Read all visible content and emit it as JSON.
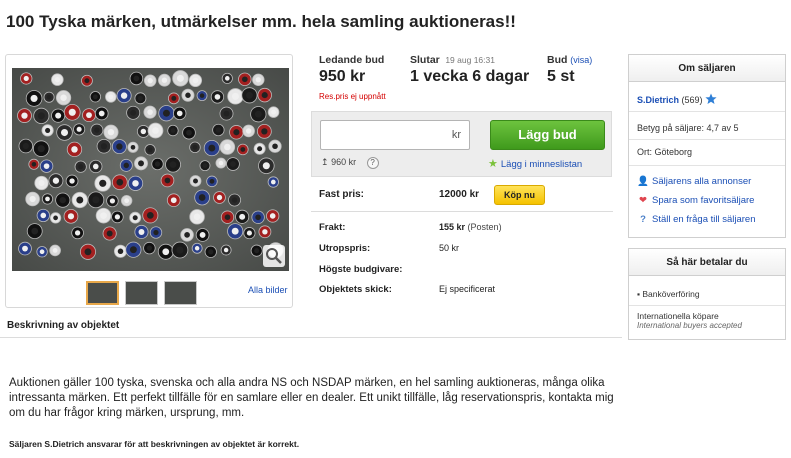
{
  "listing": {
    "title": "100 Tyska märken, utmärkelser mm. hela samling auktioneras!!"
  },
  "gallery": {
    "all_images_label": "Alla bilder",
    "thumbnail_count": 3
  },
  "bid_info": {
    "leading_bid_label": "Ledande bud",
    "leading_bid_value": "950 kr",
    "reserve_note": "Res.pris ej uppnått",
    "ends_label": "Slutar",
    "ends_date": "19 aug 16:31",
    "ends_value": "1 vecka 6 dagar",
    "bids_label": "Bud",
    "bids_link": "(visa)",
    "bids_value": "5 st"
  },
  "bid_form": {
    "input_value": "",
    "input_unit": "kr",
    "submit_label": "Lägg bud",
    "min_bid": "960 kr",
    "help_label": "?",
    "watchlist_label": "Lägg i minneslistan"
  },
  "fixed_price": {
    "label": "Fast pris:",
    "value": "12000 kr",
    "buy_now_label": "Köp nu"
  },
  "details": [
    {
      "label": "Frakt:",
      "value": "155 kr",
      "extra": "(Posten)"
    },
    {
      "label": "Utropspris:",
      "value": "50 kr",
      "extra": ""
    },
    {
      "label": "Högste budgivare:",
      "value": "",
      "extra": ""
    },
    {
      "label": "Objektets skick:",
      "value": "Ej specificerat",
      "extra": ""
    }
  ],
  "seller": {
    "heading": "Om säljaren",
    "name": "S.Dietrich",
    "rating_count": "(569)",
    "grade_text": "Betyg på säljare:  4,7 av 5",
    "location_text": "Ort:  Göteborg",
    "links": [
      {
        "label": "Säljarens alla annonser",
        "icon": "person-icon",
        "color": "#4a7fc8"
      },
      {
        "label": "Spara som favoritsäljare",
        "icon": "heart-icon",
        "color": "#e0454f"
      },
      {
        "label": "Ställ en fråga till säljaren",
        "icon": "question-icon",
        "color": "#4a7fc8"
      }
    ]
  },
  "payment": {
    "heading": "Så här betalar du",
    "methods": [
      {
        "label": "Banköverföring",
        "sub": ""
      },
      {
        "label": "Internationella köpare",
        "sub": "International buyers accepted"
      }
    ]
  },
  "description": {
    "heading": "Beskrivning av objektet",
    "text": "Auktionen gäller 100 tyska, svenska och alla andra NS och NSDAP märken, en hel samling auktioneras, många olika intressanta märken. Ett perfekt tillfälle för en samlare eller en dealer. Ett unikt tillfälle, låg reservationspris, kontakta mig om du har frågor kring märken, ursprung, mm.",
    "disclaimer": "Säljaren S.Dietrich ansvarar för att beskrivningen av objektet är korrekt."
  },
  "colors": {
    "link": "#1b4fb5",
    "bid_button": "#4fae27",
    "buy_now": "#f7c90c",
    "reserve_text": "#d40000",
    "verified_star": "#2f7fd6"
  }
}
